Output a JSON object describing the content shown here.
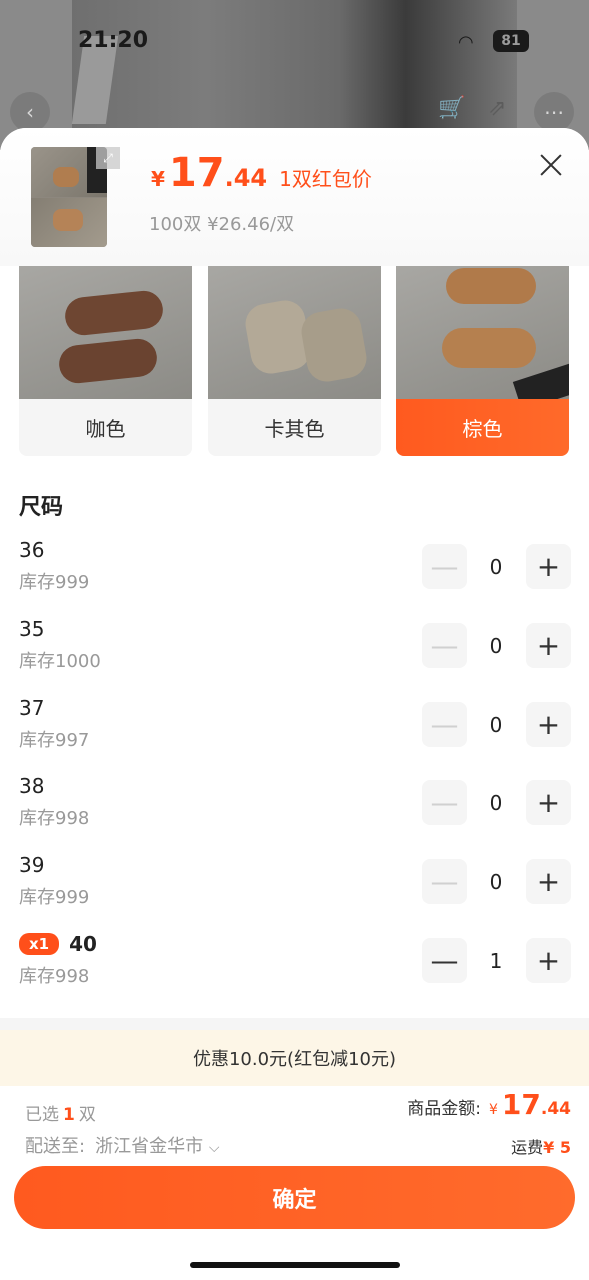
{
  "status_bar": {
    "time": "21:20",
    "battery": "81"
  },
  "header": {
    "currency": "¥",
    "price_int": "17",
    "price_dec": ".44",
    "price_label": "1双红包价",
    "tier_price": "100双 ¥26.46/双"
  },
  "colors": [
    {
      "label": "咖色",
      "selected": false
    },
    {
      "label": "卡其色",
      "selected": false
    },
    {
      "label": "棕色",
      "selected": true
    }
  ],
  "size_section_title": "尺码",
  "sizes": [
    {
      "size": "36",
      "stock": "库存999",
      "qty": "0",
      "badge": ""
    },
    {
      "size": "35",
      "stock": "库存1000",
      "qty": "0",
      "badge": ""
    },
    {
      "size": "37",
      "stock": "库存997",
      "qty": "0",
      "badge": ""
    },
    {
      "size": "38",
      "stock": "库存998",
      "qty": "0",
      "badge": ""
    },
    {
      "size": "39",
      "stock": "库存999",
      "qty": "0",
      "badge": ""
    },
    {
      "size": "40",
      "stock": "库存998",
      "qty": "1",
      "badge": "x1"
    }
  ],
  "promo": "优惠10.0元(红包减10元)",
  "footer": {
    "selected_prefix": "已选",
    "selected_count": "1",
    "selected_unit": "双",
    "ship_label": "配送至:",
    "ship_address": "浙江省金华市",
    "amount_label": "商品金额:",
    "amount_currency": "¥",
    "amount_int": "17",
    "amount_dec": ".44",
    "freight_label": "运费",
    "freight_value": "¥ 5",
    "confirm_label": "确定"
  }
}
